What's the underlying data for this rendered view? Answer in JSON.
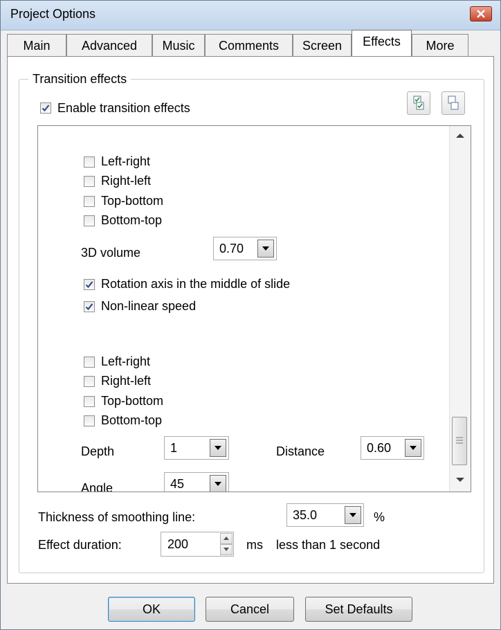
{
  "window": {
    "title": "Project Options"
  },
  "tabs": [
    "Main",
    "Advanced",
    "Music",
    "Comments",
    "Screen",
    "Effects",
    "More"
  ],
  "active_tab": "Effects",
  "group": {
    "label": "Transition effects",
    "enable_label": "Enable transition effects",
    "enable_checked": true
  },
  "list": {
    "directions_a": [
      "Left-right",
      "Right-left",
      "Top-bottom",
      "Bottom-top"
    ],
    "volume_label": "3D volume",
    "volume_value": "0.70",
    "rotation_label": "Rotation axis in the middle of slide",
    "nonlinear_label": "Non-linear speed",
    "directions_b": [
      "Left-right",
      "Right-left",
      "Top-bottom",
      "Bottom-top"
    ],
    "depth_label": "Depth",
    "depth_value": "1",
    "distance_label": "Distance",
    "distance_value": "0.60",
    "angle_label": "Angle",
    "angle_value": "45"
  },
  "smoothing": {
    "label": "Thickness of smoothing line:",
    "value": "35.0",
    "unit": "%"
  },
  "duration": {
    "label": "Effect duration:",
    "value": "200",
    "unit": "ms",
    "note": "less than 1 second"
  },
  "buttons": {
    "ok": "OK",
    "cancel": "Cancel",
    "defaults": "Set Defaults"
  },
  "icons": [
    "close-icon",
    "check-all-icon",
    "uncheck-all-icon",
    "dropdown-arrow-icon",
    "scroll-up-icon",
    "scroll-down-icon",
    "spin-up-icon",
    "spin-down-icon"
  ]
}
